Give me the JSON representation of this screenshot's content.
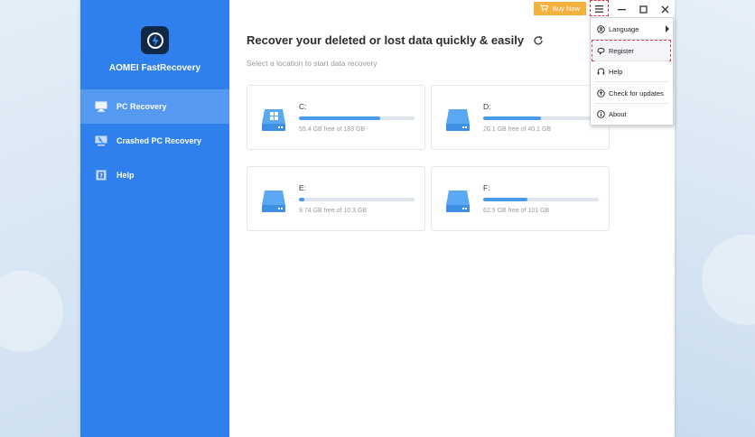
{
  "app": {
    "name": "AOMEI FastRecovery"
  },
  "sidebar": {
    "items": [
      {
        "label": "PC Recovery",
        "icon": "monitor-icon",
        "active": true
      },
      {
        "label": "Crashed PC Recovery",
        "icon": "crashed-pc-icon",
        "active": false
      },
      {
        "label": "Help",
        "icon": "help-book-icon",
        "active": false
      }
    ]
  },
  "titlebar": {
    "buy_label": "Buy Now",
    "buy_color": "#f4b13e"
  },
  "main": {
    "title": "Recover your deleted or lost data quickly & easily",
    "subtitle": "Select a location to start data recovery"
  },
  "drives": [
    {
      "name": "C:",
      "info": "55.4 GB free of 183 GB",
      "used_fraction": 0.7,
      "type": "windows-drive"
    },
    {
      "name": "D:",
      "info": "20.1 GB free of 40.1 GB",
      "used_fraction": 0.5,
      "type": "drive"
    },
    {
      "name": "E:",
      "info": "9.74 GB free of 10.3 GB",
      "used_fraction": 0.05,
      "type": "drive"
    },
    {
      "name": "F:",
      "info": "62.5 GB free of 101 GB",
      "used_fraction": 0.38,
      "type": "drive"
    }
  ],
  "menu": {
    "items": [
      {
        "label": "Language",
        "icon": "language-icon",
        "has_submenu": true
      },
      {
        "label": "Register",
        "icon": "register-icon",
        "has_submenu": false
      },
      {
        "label": "Help",
        "icon": "headset-icon",
        "has_submenu": false
      },
      {
        "label": "Check for updates",
        "icon": "update-icon",
        "has_submenu": false
      },
      {
        "label": "About",
        "icon": "info-icon",
        "has_submenu": false
      }
    ]
  },
  "colors": {
    "sidebar": "#2f80ec",
    "sidebar_active": "#5599f1",
    "accent": "#4a9bef",
    "highlight": "#e0364d"
  }
}
